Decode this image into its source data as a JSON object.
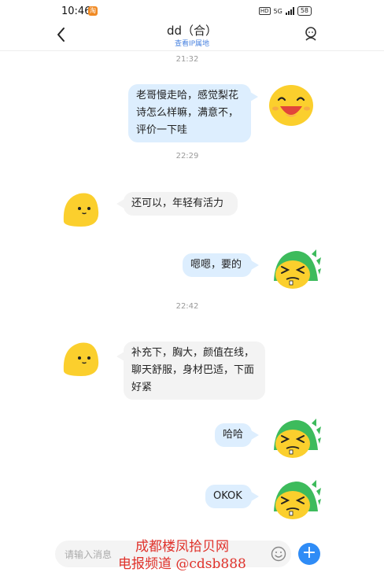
{
  "status_bar": {
    "time": "10:46",
    "notif_badge": "淘",
    "signal_label": "5G",
    "hd_label": "HD",
    "battery": "58"
  },
  "header": {
    "title": "dd（合）",
    "subtitle": "查看IP属地"
  },
  "messages": [
    {
      "timestamp": "21:32"
    },
    {
      "from": "me",
      "text": "老哥慢走哈，感觉梨花诗怎么样嘛，满意不，评价一下哇"
    },
    {
      "timestamp": "22:29"
    },
    {
      "from": "other",
      "text": "还可以，年轻有活力"
    },
    {
      "from": "me",
      "text": "嗯嗯，要的"
    },
    {
      "timestamp": "22:42"
    },
    {
      "from": "other",
      "text": "补充下，胸大，颜值在线，聊天舒服，身材巴适，下面好紧"
    },
    {
      "from": "me",
      "text": "哈哈"
    },
    {
      "from": "me",
      "text": "OKOK"
    }
  ],
  "input": {
    "placeholder": "请输入消息"
  },
  "watermark": {
    "line1": "成都楼凤拾贝网",
    "line2": "电报频道 @cdsb888"
  },
  "colors": {
    "my_bubble": "#ddeefe",
    "other_bubble": "#f3f3f3",
    "accent": "#2f8cf6",
    "watermark": "#e0322b"
  }
}
